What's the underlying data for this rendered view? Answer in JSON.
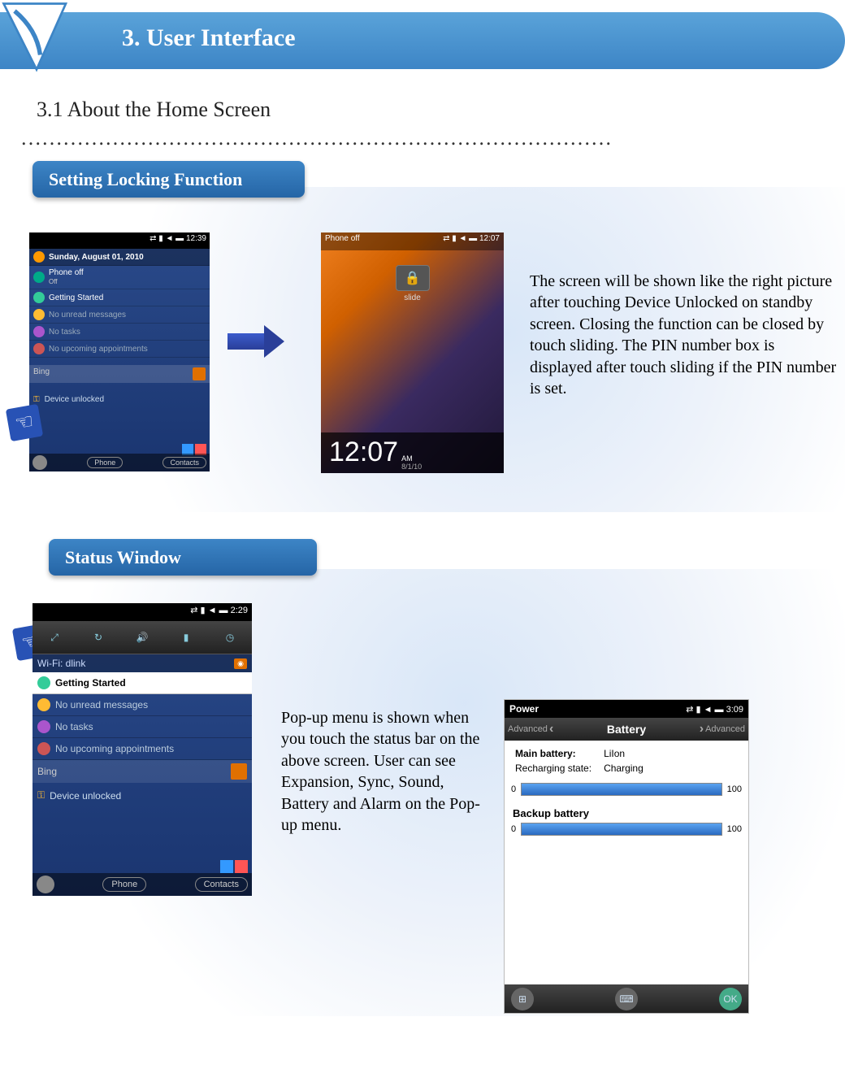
{
  "header": {
    "title": "3. User Interface"
  },
  "section": {
    "number_title": "3.1 About the Home Screen",
    "dots": "…………………………………………………………………………"
  },
  "banner1": "Setting Locking Function",
  "banner2": "Status Window",
  "desc1": "The screen will be shown like the right picture after touching Device Unlocked on standby screen. Closing the function can be closed by touch sliding. The PIN number box is displayed after touch sliding if the PIN number is set.",
  "desc2": "Pop-up menu is shown when you touch the status bar on the above screen. User can see Expansion, Sync, Sound, Battery and Alarm on the Pop-up menu.",
  "phone1": {
    "status_time": "12:39",
    "date": "Sunday, August 01, 2010",
    "phone_off": "Phone off",
    "off_sub": "Off",
    "rows": [
      "Getting Started",
      "No unread messages",
      "No tasks",
      "No upcoming appointments"
    ],
    "bing": "Bing",
    "unlocked": "Device unlocked",
    "btn_phone": "Phone",
    "btn_contacts": "Contacts"
  },
  "phone2": {
    "topleft": "Phone off",
    "status_time": "12:07",
    "slide": "slide",
    "clock": "12:07",
    "ampm": "AM",
    "date": "8/1/10"
  },
  "phone3": {
    "status_time": "2:29",
    "wifi": "Wi-Fi: dlink",
    "rows": [
      "Getting Started",
      "No unread messages",
      "No tasks",
      "No upcoming appointments"
    ],
    "bing": "Bing",
    "unlocked": "Device unlocked",
    "btn_phone": "Phone",
    "btn_contacts": "Contacts"
  },
  "phone4": {
    "title": "Power",
    "status_time": "3:09",
    "tab_left": "Advanced",
    "tab_center": "Battery",
    "tab_right": "Advanced",
    "main_label": "Main battery:",
    "main_type": "LiIon",
    "recharge_label": "Recharging state:",
    "recharge_val": "Charging",
    "bar_min": "0",
    "bar_max": "100",
    "backup_label": "Backup battery",
    "main_pct": 100,
    "backup_pct": 100,
    "ok": "OK"
  }
}
